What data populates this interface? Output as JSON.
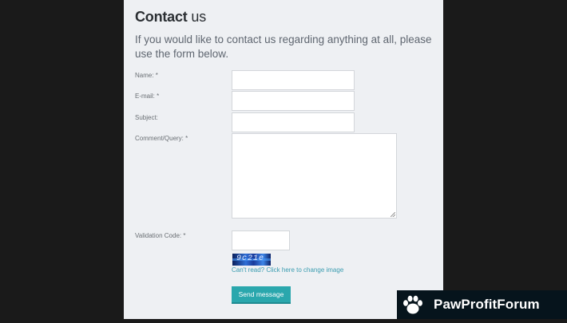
{
  "form": {
    "title_bold": "Contact",
    "title_rest": " us",
    "intro": "If you would like to contact us regarding anything at all, please use the form below.",
    "fields": {
      "name_label": "Name: *",
      "email_label": "E-mail: *",
      "subject_label": "Subject:",
      "comment_label": "Comment/Query: *",
      "validation_label": "Validation Code: *"
    },
    "captcha_text": "9c21e",
    "change_image_link": "Can't read? Click here to change image",
    "send_label": "Send message"
  },
  "watermark": {
    "text": "PawProfitForum",
    "icon": "paw-icon"
  }
}
